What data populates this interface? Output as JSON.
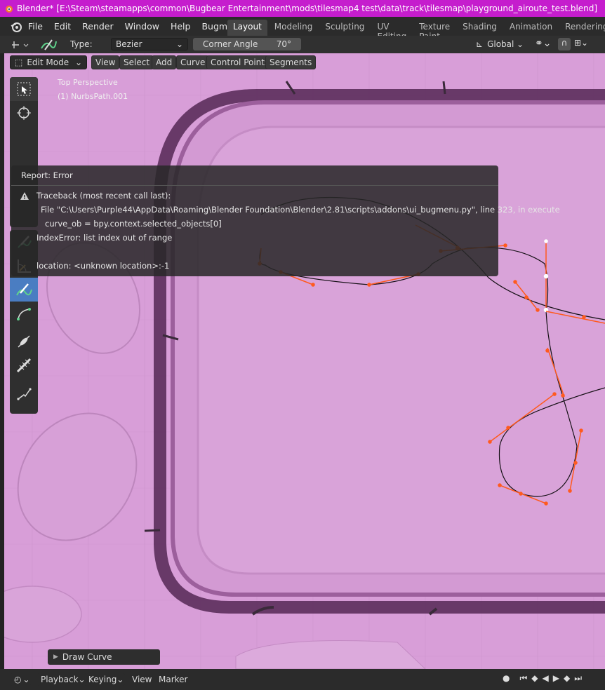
{
  "window": {
    "title": "Blender* [E:\\Steam\\steamapps\\common\\Bugbear Entertainment\\mods\\tilesmap4 test\\data\\track\\tilesmap\\playground_airoute_test.blend]"
  },
  "menu": {
    "items": [
      "File",
      "Edit",
      "Render",
      "Window",
      "Help",
      "Bugmenu"
    ]
  },
  "workspaces": {
    "tabs": [
      "Layout",
      "Modeling",
      "Sculpting",
      "UV Editing",
      "Texture Paint",
      "Shading",
      "Animation",
      "Rendering"
    ],
    "active": "Layout"
  },
  "tool_header": {
    "type_label": "Type:",
    "type_value": "Bezier",
    "corner_angle_label": "Corner Angle",
    "corner_angle_value": "70°",
    "orientation": "Global"
  },
  "viewport_header": {
    "mode": "Edit Mode",
    "menus": [
      "View",
      "Select",
      "Add",
      "Curve",
      "Control Points",
      "Segments"
    ]
  },
  "viewport": {
    "perspective": "Top Perspective",
    "object": "(1) NurbsPath.001",
    "background_color": "#d89ed8"
  },
  "report": {
    "title": "Report: Error",
    "lines": [
      "Traceback (most recent call last):",
      "File \"C:\\Users\\Purple44\\AppData\\Roaming\\Blender Foundation\\Blender\\2.81\\scripts\\addons\\ui_bugmenu.py\", line 323, in execute",
      "curve_ob = bpy.context.selected_objects[0]",
      "IndexError: list index out of range",
      "location: <unknown location>:-1"
    ]
  },
  "toolbar_icons": [
    "select-box-icon",
    "cursor-icon",
    "move-icon",
    "rotate-icon",
    "scale-icon",
    "transform-icon",
    "annotate-icon",
    "measure-icon",
    "draw-curve-icon",
    "extrude-curve-icon",
    "tilt-icon",
    "radius-icon",
    "randomize-icon"
  ],
  "last_operator": {
    "label": "Draw Curve"
  },
  "timeline": {
    "menus": [
      "Playback",
      "Keying",
      "View",
      "Marker"
    ]
  },
  "colors": {
    "title_bar": "#c51dcd",
    "handle": "#ff5a1e",
    "active_tool": "#4a7dc2"
  }
}
